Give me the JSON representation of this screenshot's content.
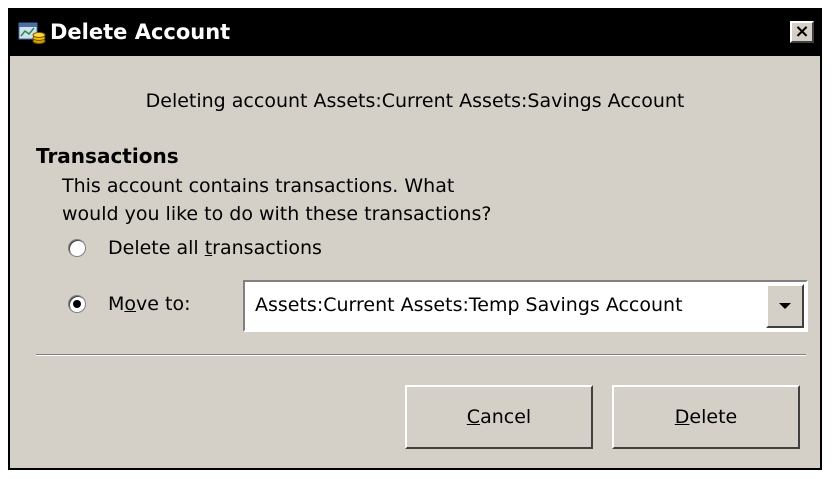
{
  "dialog": {
    "title": "Delete Account",
    "close_label": "×",
    "icon": "accounts-app-icon"
  },
  "message": "Deleting account Assets:Current Assets:Savings Account",
  "transactions": {
    "heading": "Transactions",
    "description_line1": "This account contains transactions. What",
    "description_line2": "would you like to do with these transactions?",
    "option_delete": {
      "prefix": "Delete all ",
      "mnemonic": "t",
      "suffix": "ransactions",
      "checked": false
    },
    "option_move": {
      "prefix": "M",
      "mnemonic": "o",
      "suffix": "ve to:",
      "checked": true
    },
    "move_target": "Assets:Current Assets:Temp Savings Account"
  },
  "buttons": {
    "cancel": {
      "mnemonic": "C",
      "rest": "ancel"
    },
    "delete": {
      "mnemonic": "D",
      "rest": "elete"
    }
  },
  "colors": {
    "dialog_bg": "#d4d0c8",
    "titlebar_bg": "#000000",
    "titlebar_text": "#ffffff"
  }
}
